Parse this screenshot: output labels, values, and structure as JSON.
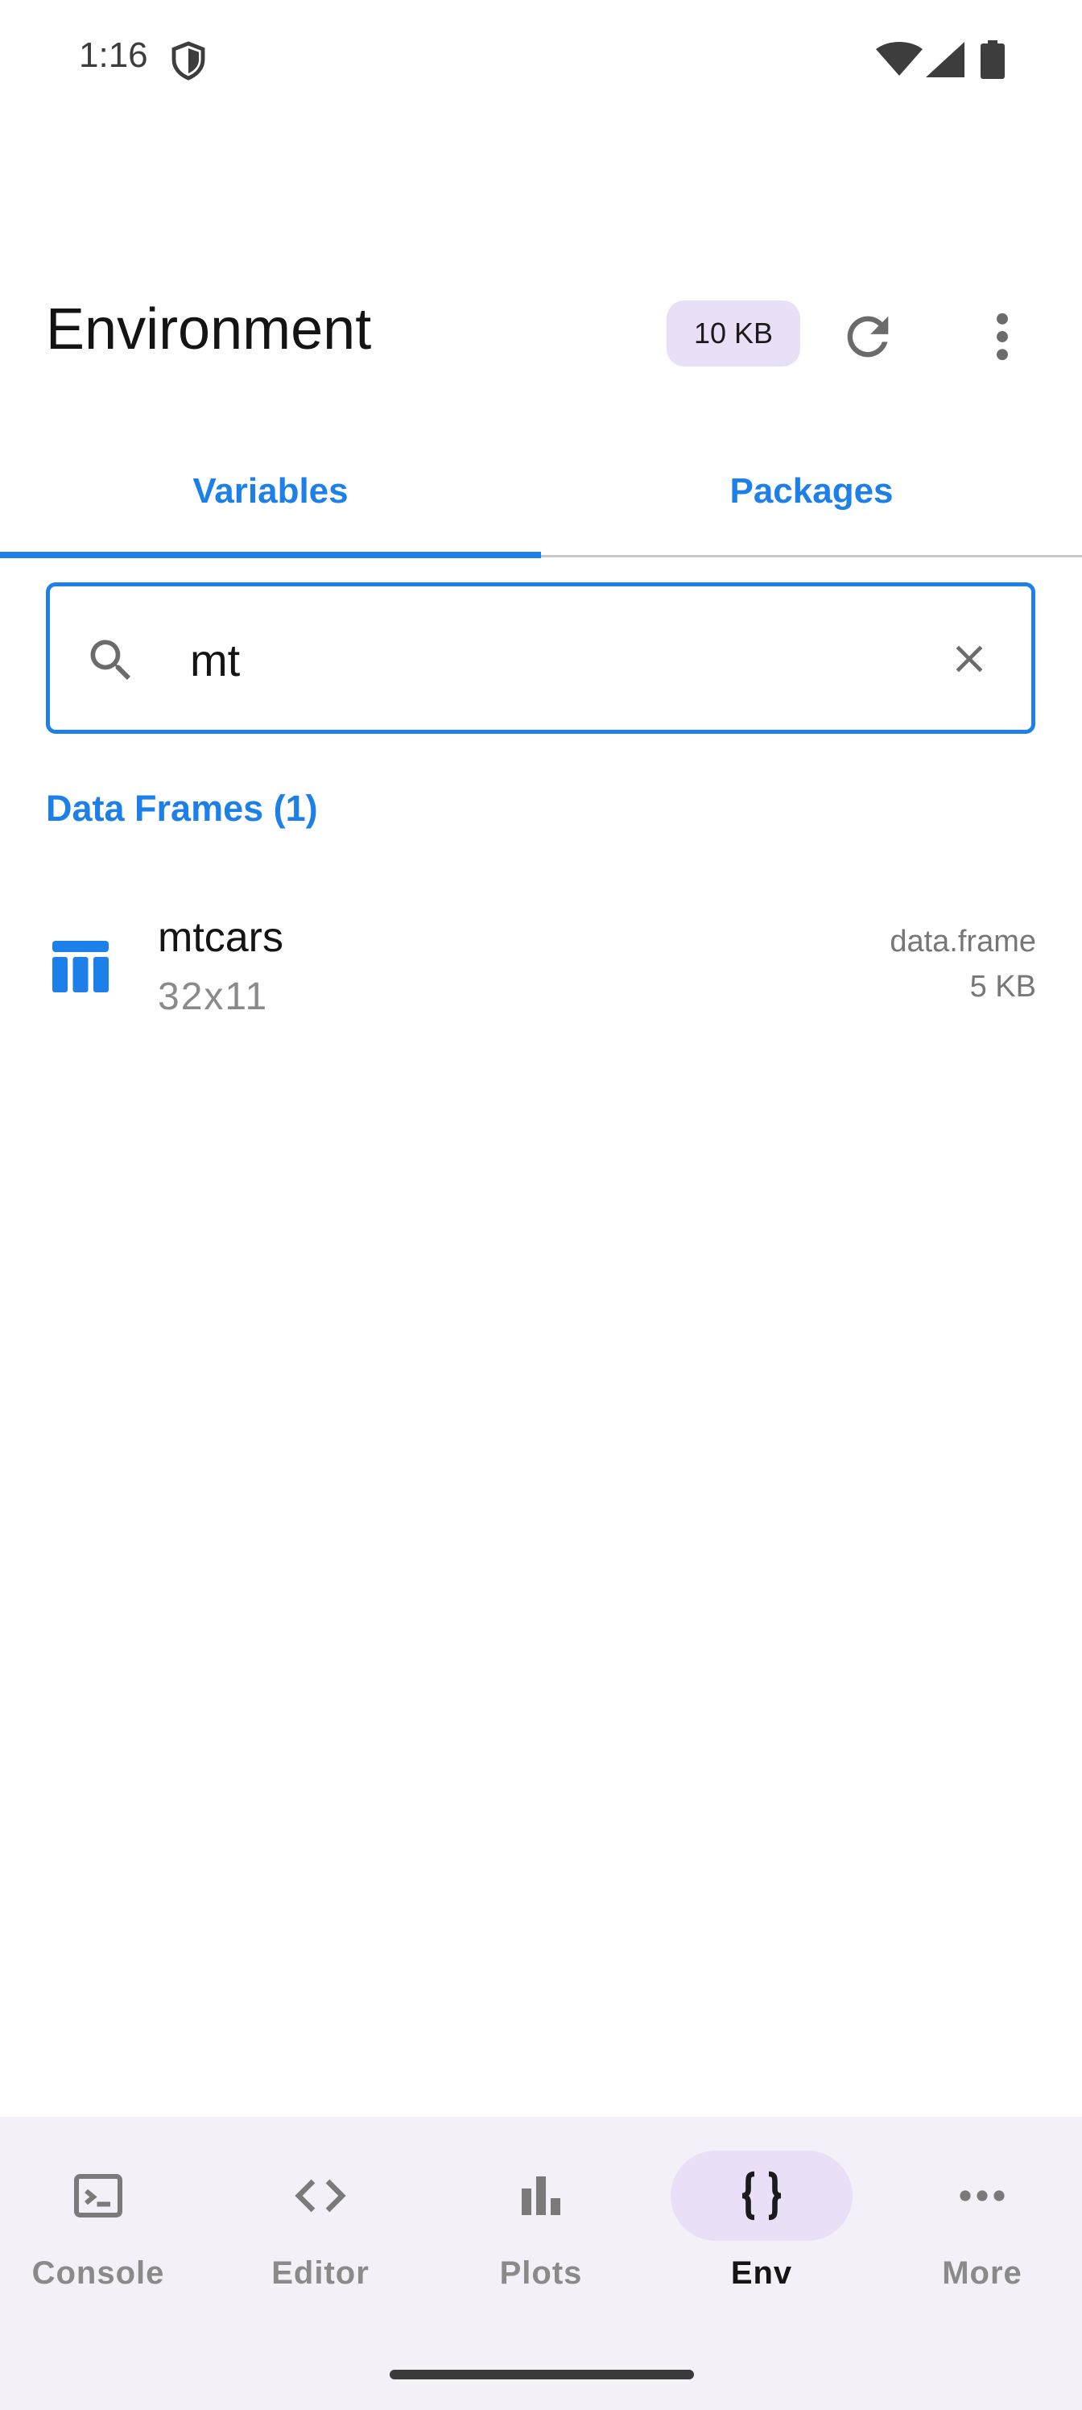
{
  "status_bar": {
    "time": "1:16"
  },
  "header": {
    "title": "Environment",
    "size_badge": "10 KB"
  },
  "tabs": [
    {
      "label": "Variables",
      "active": true
    },
    {
      "label": "Packages",
      "active": false
    }
  ],
  "search": {
    "value": "mt"
  },
  "section": {
    "title": "Data Frames (1)"
  },
  "items": [
    {
      "name": "mtcars",
      "dims": "32x11",
      "type": "data.frame",
      "size": "5 KB",
      "icon": "table-icon"
    }
  ],
  "bottom_nav": [
    {
      "label": "Console",
      "icon": "terminal-icon",
      "active": false
    },
    {
      "label": "Editor",
      "icon": "code-icon",
      "active": false
    },
    {
      "label": "Plots",
      "icon": "bar-chart-icon",
      "active": false
    },
    {
      "label": "Env",
      "icon": "braces-icon",
      "active": true
    },
    {
      "label": "More",
      "icon": "more-horiz-icon",
      "active": false
    }
  ],
  "colors": {
    "accent": "#1d7fe8",
    "active_pill": "#e9e0f7",
    "nav_background": "#f3f1f7"
  }
}
